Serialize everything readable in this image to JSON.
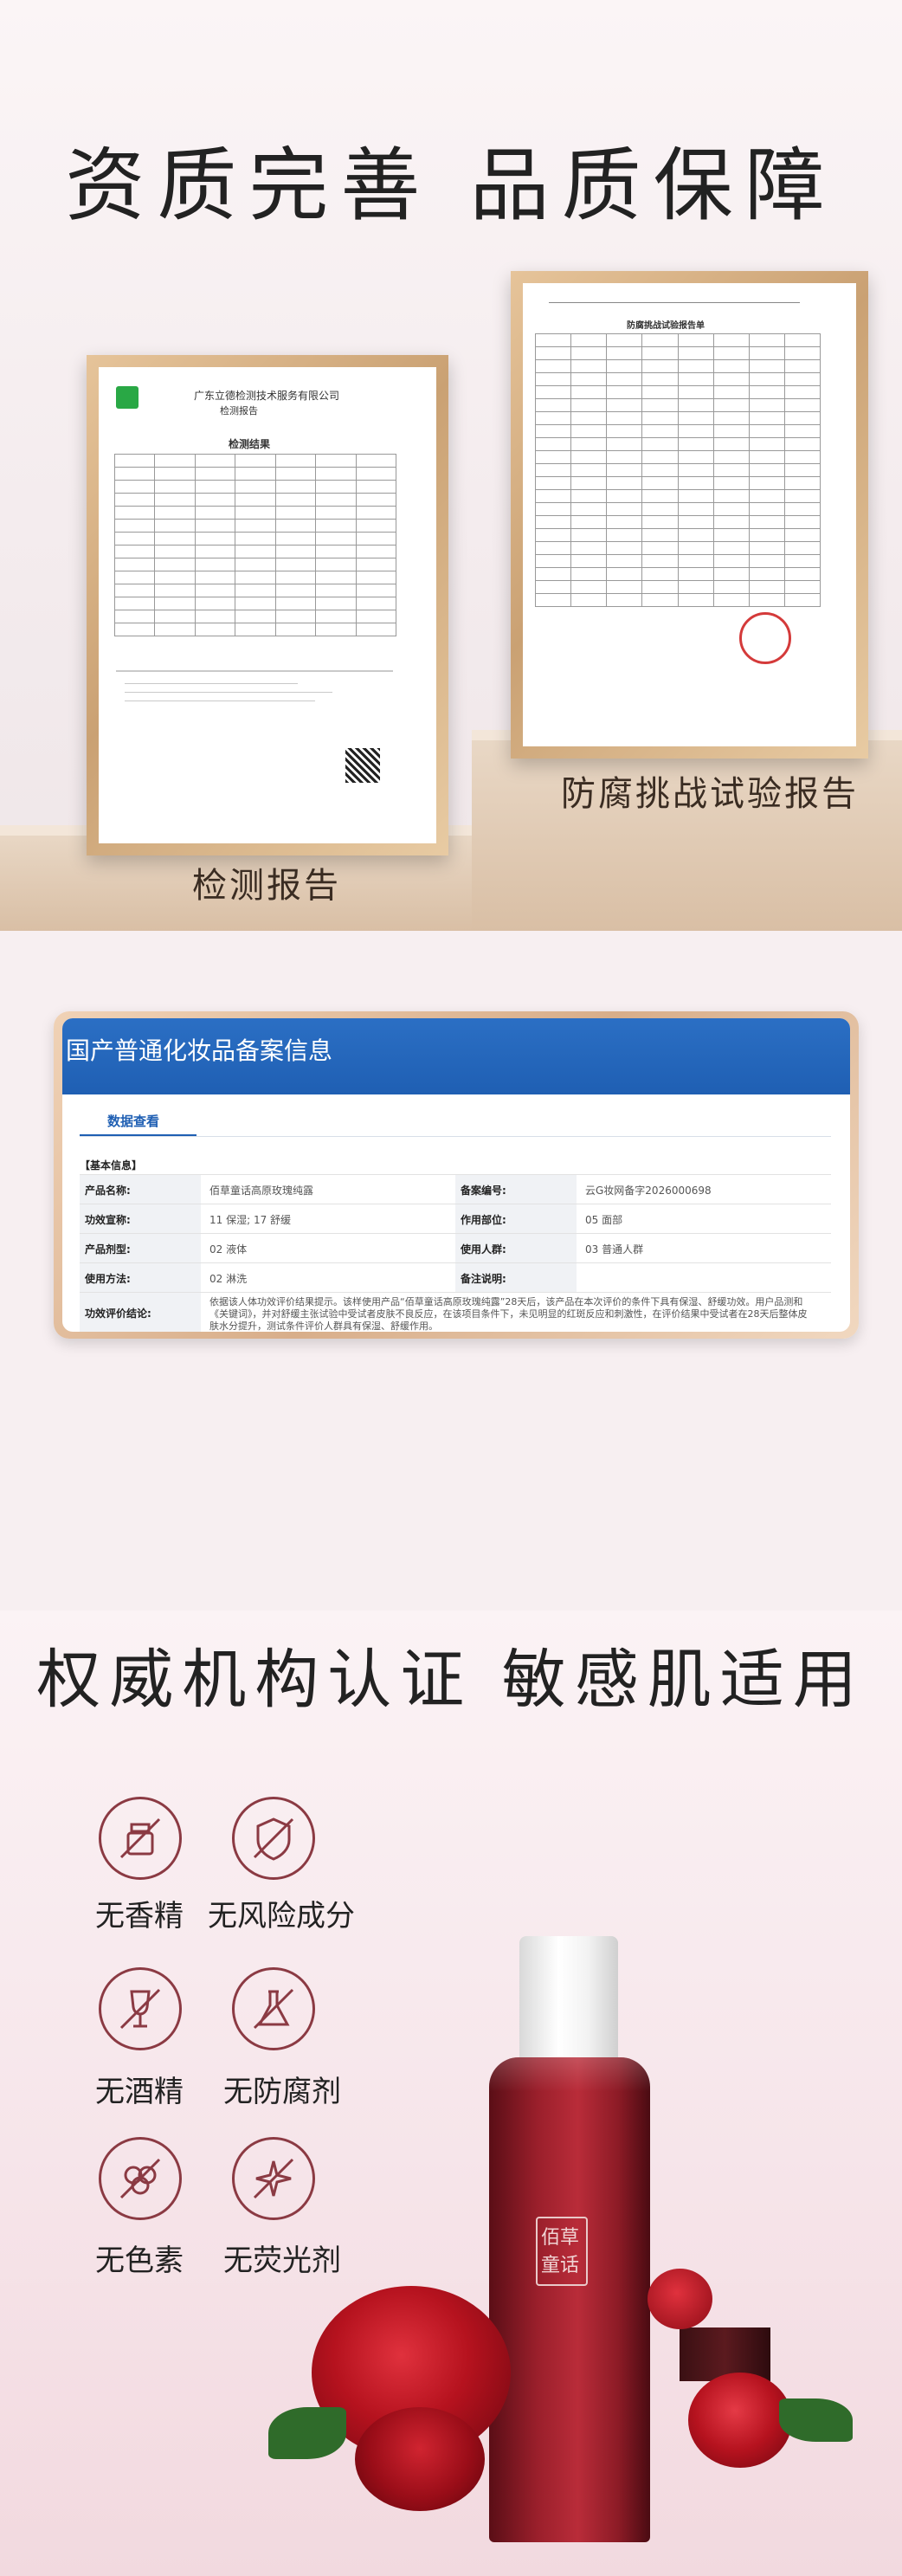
{
  "section1": {
    "headline": "资质完善 品质保障",
    "caption_left": "检测报告",
    "caption_right": "防腐挑战试验报告",
    "report1": {
      "company": "广东立德检测技术服务有限公司",
      "doc_type": "检测报告",
      "section_title": "检测结果"
    },
    "report2": {
      "title": "防腐挑战试验报告单"
    }
  },
  "section2": {
    "card_title": "国产普通化妆品备案信息",
    "tab": "数据查看",
    "section_label": "【基本信息】",
    "rows": [
      {
        "label": "产品名称:",
        "value": "佰草童话高原玫瑰纯露",
        "label2": "备案编号:",
        "value2": "云G妆网备字2026000698"
      },
      {
        "label": "功效宣称:",
        "value": "11 保湿; 17 舒缓",
        "label2": "作用部位:",
        "value2": "05 面部"
      },
      {
        "label": "产品剂型:",
        "value": "02 液体",
        "label2": "使用人群:",
        "value2": "03 普通人群"
      },
      {
        "label": "使用方法:",
        "value": "02 淋洗",
        "label2": "备注说明:",
        "value2": ""
      }
    ],
    "claim_label": "功效评价结论:",
    "claim_text": "依据该人体功效评价结果提示。该样使用产品“佰草童话高原玫瑰纯露”28天后，该产品在本次评价的条件下具有保湿、舒缓功效。用户品测和《关键词》，并对舒缓主张试验中受试者皮肤不良反应，在该项目条件下，未见明显的红斑反应和刺激性，在评价结果中受试者在28天后整体皮肤水分提升，测试条件评价人群具有保湿、舒缓作用。"
  },
  "section3": {
    "headline": "权威机构认证 敏感肌适用",
    "badges": [
      {
        "label": "无香精",
        "icon": "no-fragrance-icon"
      },
      {
        "label": "无风险成分",
        "icon": "no-risk-ingredient-icon"
      },
      {
        "label": "无酒精",
        "icon": "no-alcohol-icon"
      },
      {
        "label": "无防腐剂",
        "icon": "no-preservative-icon"
      },
      {
        "label": "无色素",
        "icon": "no-pigment-icon"
      },
      {
        "label": "无荧光剂",
        "icon": "no-fluorescent-icon"
      }
    ],
    "bottle_logo_line1": "佰草",
    "bottle_logo_line2": "童话"
  },
  "colors": {
    "accent": "#8b3a43",
    "card_blue": "#1f5fb3",
    "gold_frame": "#caa173"
  }
}
